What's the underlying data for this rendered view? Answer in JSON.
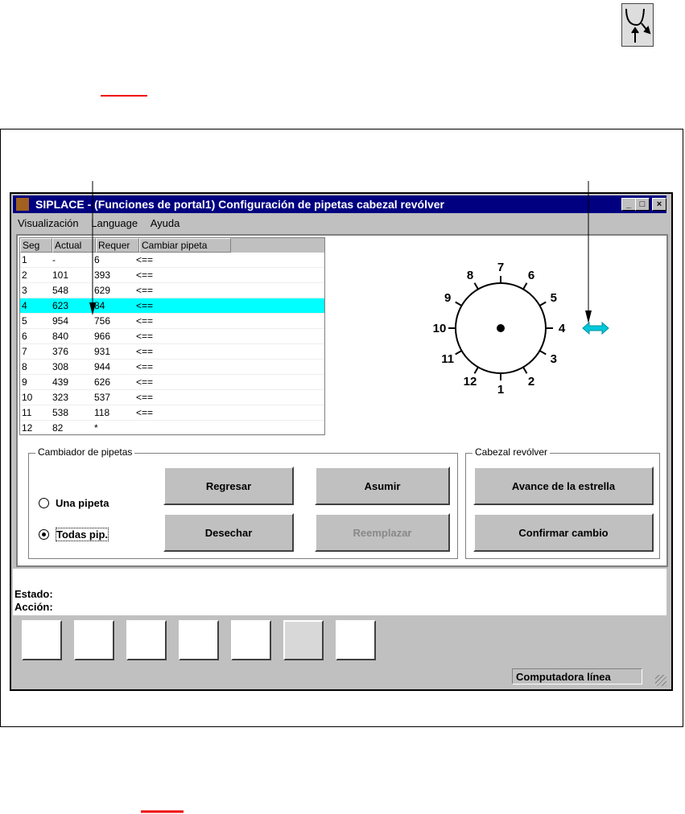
{
  "window": {
    "title": "SIPLACE - (Funciones de portal1) Configuración de pipetas cabezal revólver",
    "controls": [
      "_",
      "□",
      "×"
    ]
  },
  "menu": [
    "Visualización",
    "Language",
    "Ayuda"
  ],
  "table": {
    "headers": [
      "Seg",
      "Actual",
      "Requer",
      "Cambiar pipeta"
    ],
    "rows": [
      [
        "1",
        "-",
        "6",
        "<=="
      ],
      [
        "2",
        "101",
        "393",
        "<=="
      ],
      [
        "3",
        "548",
        "629",
        "<=="
      ],
      [
        "4",
        "623",
        "84",
        "<=="
      ],
      [
        "5",
        "954",
        "756",
        "<=="
      ],
      [
        "6",
        "840",
        "966",
        "<=="
      ],
      [
        "7",
        "376",
        "931",
        "<=="
      ],
      [
        "8",
        "308",
        "944",
        "<=="
      ],
      [
        "9",
        "439",
        "626",
        "<=="
      ],
      [
        "10",
        "323",
        "537",
        "<=="
      ],
      [
        "11",
        "538",
        "118",
        "<=="
      ],
      [
        "12",
        "82",
        "*",
        ""
      ]
    ],
    "selected_row": 4,
    "highlight_color": "#00ffff"
  },
  "dial": {
    "labels": [
      "1",
      "2",
      "3",
      "4",
      "5",
      "6",
      "7",
      "8",
      "9",
      "10",
      "11",
      "12"
    ],
    "arrow_color": "#00c8d8"
  },
  "changer": {
    "title": "Cambiador de pipetas",
    "options": [
      {
        "label": "Una pipeta",
        "checked": false
      },
      {
        "label": "Todas pip.",
        "checked": true
      }
    ],
    "buttons": {
      "back": "Regresar",
      "accept": "Asumir",
      "discard": "Desechar",
      "replace": "Reemplazar"
    }
  },
  "head": {
    "title": "Cabezal revólver",
    "buttons": {
      "advance": "Avance de la estrella",
      "confirm": "Confirmar cambio"
    }
  },
  "status": {
    "state_label": "Estado:",
    "action_label": "Acción:"
  },
  "toolbar": [
    "select-window-icon",
    "gantry-move-icon",
    "revolver-head-icon",
    "nozzle-up-icon",
    "nozzle-height-icon",
    "nozzle-change-icon",
    "nozzle-tray-icon"
  ],
  "statusbar": {
    "computer": "Computadora línea"
  }
}
